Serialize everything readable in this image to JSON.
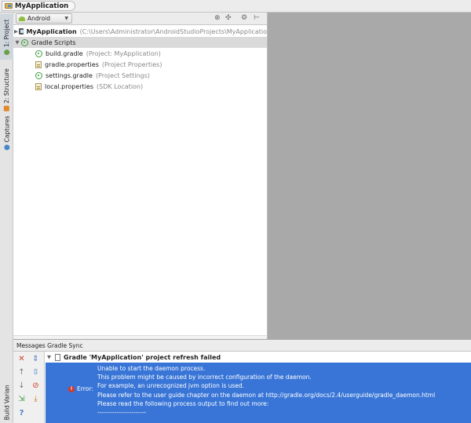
{
  "breadcrumb": {
    "project_name": "MyApplication"
  },
  "left_tabs": {
    "project": "1: Project",
    "structure": "2: Structure",
    "captures": "Captures",
    "build_variants": "Build Variants"
  },
  "toolbar": {
    "view_mode": "Android",
    "icons": [
      "target-icon",
      "collapse-icon",
      "gear-icon",
      "pin-icon"
    ]
  },
  "tree": {
    "root": {
      "name": "MyApplication",
      "path": "(C:\\Users\\Administrator\\AndroidStudioProjects\\MyApplicatio"
    },
    "scripts_group": "Gradle Scripts",
    "files": [
      {
        "name": "build.gradle",
        "hint": "(Project: MyApplication)",
        "icon": "gradle-icon"
      },
      {
        "name": "gradle.properties",
        "hint": "(Project Properties)",
        "icon": "properties-icon"
      },
      {
        "name": "settings.gradle",
        "hint": "(Project Settings)",
        "icon": "gradle-icon"
      },
      {
        "name": "local.properties",
        "hint": "(SDK Location)",
        "icon": "properties-icon"
      }
    ]
  },
  "messages": {
    "header": "Messages Gradle Sync",
    "title": "Gradle 'MyApplication' project refresh failed",
    "error_label": "Error:",
    "lines": [
      "Unable to start the daemon process.",
      "This problem might be caused by incorrect configuration of the daemon.",
      "For example, an unrecognized jvm option is used.",
      "Please refer to the user guide chapter on the daemon at http://gradle.org/docs/2.4/userguide/gradle_daemon.html",
      "Please read the following process output to find out more:",
      "-----------------------"
    ]
  },
  "colors": {
    "selection": "#3875d7",
    "error": "#d23a2a",
    "gradle": "#3d9c3d"
  }
}
